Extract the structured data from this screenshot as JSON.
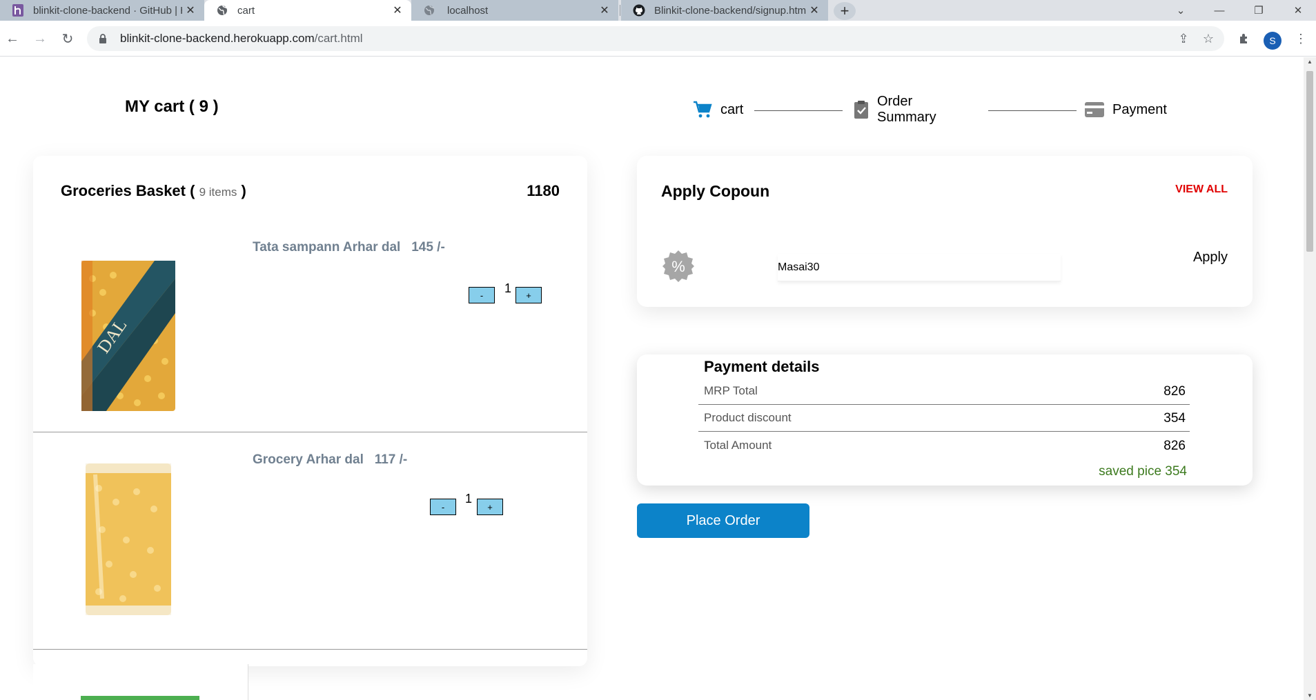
{
  "browser": {
    "tabs": [
      {
        "title": "blinkit-clone-backend · GitHub | H",
        "icon": "heroku-icon",
        "active": false
      },
      {
        "title": "cart",
        "icon": "globe-icon",
        "active": true
      },
      {
        "title": "localhost",
        "icon": "globe-icon",
        "active": false
      },
      {
        "title": "Blinkit-clone-backend/signup.htm",
        "icon": "github-icon",
        "active": false
      }
    ],
    "url_host": "blinkit-clone-backend.herokuapp.com",
    "url_path": "/cart.html",
    "profile_initial": "S"
  },
  "page": {
    "cart_title": "MY cart ( 9 )",
    "steps": [
      "cart",
      "Order Summary",
      "Payment"
    ],
    "basket": {
      "title": "Groceries Basket (",
      "items_label": "9 items",
      "close_paren": ")",
      "total": "1180",
      "products": [
        {
          "name": "Tata sampann Arhar dal",
          "price": "145 /-",
          "qty": "1",
          "minus": "-",
          "plus": "+"
        },
        {
          "name": "Grocery Arhar dal",
          "price": "117 /-",
          "qty": "1",
          "minus": "-",
          "plus": "+"
        }
      ]
    },
    "coupon": {
      "title": "Apply Copoun",
      "view_all": "VIEW ALL",
      "code": "Masai30",
      "apply": "Apply",
      "badge_symbol": "%"
    },
    "payment": {
      "title": "Payment details",
      "rows": [
        {
          "label": "MRP Total",
          "value": "826"
        },
        {
          "label": "Product discount",
          "value": "354"
        },
        {
          "label": "Total Amount",
          "value": "826"
        }
      ],
      "saved": "saved pice 354"
    },
    "place_order": "Place Order"
  },
  "colors": {
    "accent": "#0c83c9",
    "view_all": "#e00000",
    "saved": "#3c7a1e",
    "qty_button": "#87ceeb",
    "product_name": "#708090"
  }
}
